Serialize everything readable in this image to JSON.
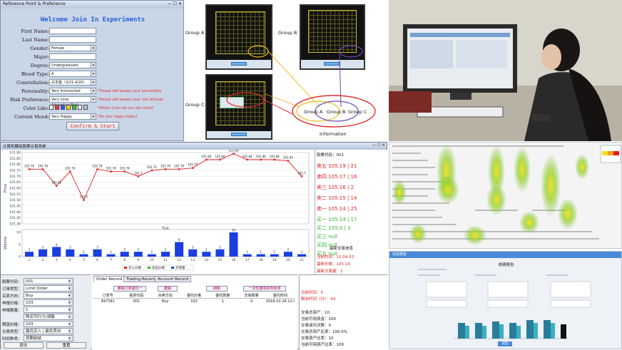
{
  "form": {
    "window_title": "Reference Point & Preference",
    "title": "Welcome Join In Experiments",
    "fields": [
      {
        "label": "First Name:",
        "value": ""
      },
      {
        "label": "Last Name:",
        "value": ""
      },
      {
        "label": "Gender:",
        "value": "Female",
        "select": true
      },
      {
        "label": "Major:",
        "value": ""
      },
      {
        "label": "Degree:",
        "value": "Undergraduate",
        "select": true
      },
      {
        "label": "Blood Type:",
        "value": "A",
        "select": true
      },
      {
        "label": "Constellation:",
        "value": "白羊座（3/21-4/20）",
        "select": true
      },
      {
        "label": "Personality:",
        "value": "Very Introverted",
        "select": true,
        "hint": "*Please self-assess your personality"
      },
      {
        "label": "Risk Preference:",
        "value": "Very Love Adventure/Risk",
        "select": true,
        "hint": "*Please self-assess your risk attitude"
      },
      {
        "label": "Color Like:",
        "value": "",
        "swatches": true,
        "hint": "*Which Color do you like most?"
      },
      {
        "label": "Current Mood:",
        "value": "Very Happy",
        "select": true,
        "hint": "*Do you happy today?"
      }
    ],
    "swatch_colors": [
      "#ffffff",
      "#ff3030",
      "#3050ff",
      "#ffe000",
      "#30c030",
      "#ffffff",
      "#c0c0c0"
    ],
    "confirm_label": "Confirm & Start"
  },
  "groups": {
    "group_a": "Group A",
    "group_b": "Group B",
    "group_c": "Group C",
    "circle_a": "Group A",
    "circle_b": "Group B",
    "circle_c": "Group C",
    "information": "Information"
  },
  "trade": {
    "window_title": "计算机模拟股票交易系统",
    "chart_data": {
      "type": "line",
      "price": {
        "ylabel": "Price",
        "xlabel": "Tick",
        "yticks": [
          "101.90",
          "101.85",
          "101.80",
          "101.75",
          "101.70",
          "101.65",
          "101.60",
          "101.55",
          "101.50",
          "101.45",
          "101.40",
          "101.35",
          "101.30"
        ],
        "ylim": [
          101.3,
          101.9
        ],
        "x": [
          1,
          2,
          3,
          4,
          5,
          6,
          7,
          8,
          9,
          10,
          11,
          12,
          13,
          14,
          15,
          16,
          17,
          18,
          19,
          20,
          21
        ],
        "values": [
          101.76,
          101.76,
          101.62,
          101.74,
          101.5,
          101.76,
          101.74,
          101.74,
          101.7,
          101.75,
          101.76,
          101.76,
          101.77,
          101.84,
          101.84,
          101.89,
          101.84,
          101.84,
          101.84,
          101.83,
          101.7
        ],
        "labels": [
          "101.76",
          "101.76",
          "101.62",
          "101.74",
          "101.5",
          "101.76",
          "101.74",
          "101.74",
          "101.7",
          "101.75",
          "101.76",
          "101.76",
          "101.77",
          "101.84",
          "101.84",
          "101.89",
          "101.84",
          "101.84",
          "101.84",
          "101.83",
          "101.7"
        ]
      },
      "volume": {
        "ylabel": "Volume",
        "x": [
          1,
          2,
          3,
          4,
          5,
          6,
          7,
          8,
          9,
          10,
          11,
          12,
          13,
          14,
          15,
          16,
          17,
          18,
          19,
          20,
          21
        ],
        "values": [
          2,
          3,
          4,
          3,
          1,
          3,
          1,
          2,
          2,
          1,
          2,
          6,
          3,
          2,
          3,
          10,
          1,
          1,
          1,
          2,
          1
        ],
        "yticks": [
          "0",
          "5",
          "10"
        ]
      },
      "legend": [
        "买入价格",
        "卖出价格",
        "交易量"
      ]
    },
    "quote": {
      "header": "股票代码：001",
      "asks": [
        "卖五 105.19 | 21",
        "卖四 105.17 | 16",
        "卖三 105.16 | 2",
        "卖二 105.15 | 14",
        "卖一 105.14 | 25"
      ],
      "bids": [
        "买一 105.14 | 17",
        "买二 105.0 | 1",
        "买三 null",
        "买四 null",
        "买五 null"
      ],
      "latest_title": "最新交易信息",
      "latest": [
        "当前时间：11:04:53",
        "最新价格：105.14",
        "最新交易量：2"
      ]
    },
    "order_form": {
      "rows": [
        {
          "label": "股票代码：",
          "value": "001"
        },
        {
          "label": "订单类型：",
          "value": "Limit Order"
        },
        {
          "label": "买卖方向：",
          "value": "Buy"
        },
        {
          "label": "申报价格：",
          "value": "103"
        },
        {
          "label": "申报数量：",
          "value": "1"
        },
        {
          "label": "",
          "value": "购买可行力(请输"
        },
        {
          "label": "期望价格：",
          "value": "103"
        },
        {
          "label": "交易类型：",
          "value": "最优买入 | 最优卖出"
        },
        {
          "label": "时间种类：",
          "value": "到期前结"
        }
      ],
      "submit_label": "提交",
      "reset_label": "重置"
    },
    "tabs": [
      "Order Record",
      "Trading Record",
      "Account Record"
    ],
    "tab_buttons": [
      "撤销订单委托一",
      "撤销",
      "刷新",
      "一次性撤单的所有单"
    ],
    "table_headers": [
      "订单号",
      "股票代码",
      "买卖方向",
      "委托价格",
      "委托数量",
      "交易数量",
      "委托时间"
    ],
    "table_rows": [
      [
        "497391",
        "001",
        "Buy",
        "103",
        "1",
        "0",
        "2018-02-26 11:04:36.0"
      ]
    ],
    "summary": [
      "当前时间：5",
      "剩余时间（分）：44",
      "交易总资产：10",
      "当前可用资金：100",
      "交易成功次数：0",
      "交易总资产比率：100.0%",
      "交易资产比率：10",
      "当前可用资产比率：100"
    ]
  },
  "report": {
    "topbar": "实验报告",
    "title": "成绩报告",
    "button": "返回"
  }
}
